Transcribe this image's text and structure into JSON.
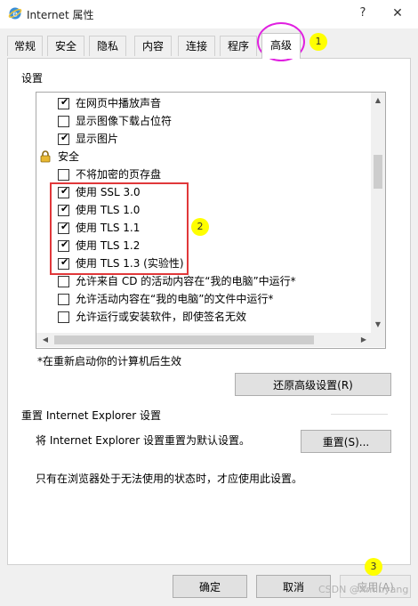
{
  "window": {
    "title": "Internet 属性",
    "help_label": "?",
    "close_label": "✕"
  },
  "tabs": [
    {
      "label": "常规",
      "active": false
    },
    {
      "label": "安全",
      "active": false
    },
    {
      "label": "隐私",
      "active": false
    },
    {
      "label": "内容",
      "active": false
    },
    {
      "label": "连接",
      "active": false
    },
    {
      "label": "程序",
      "active": false
    },
    {
      "label": "高级",
      "active": true
    }
  ],
  "settings": {
    "group_label": "设置",
    "items": [
      {
        "type": "checkbox",
        "label": "在网页中播放声音",
        "checked": true
      },
      {
        "type": "checkbox",
        "label": "显示图像下载占位符",
        "checked": false
      },
      {
        "type": "checkbox",
        "label": "显示图片",
        "checked": true
      },
      {
        "type": "category",
        "label": "安全",
        "icon": "lock-icon"
      },
      {
        "type": "checkbox",
        "label": "不将加密的页存盘",
        "checked": false
      },
      {
        "type": "checkbox",
        "label": "使用 SSL 3.0",
        "checked": true
      },
      {
        "type": "checkbox",
        "label": "使用 TLS 1.0",
        "checked": true
      },
      {
        "type": "checkbox",
        "label": "使用 TLS 1.1",
        "checked": true
      },
      {
        "type": "checkbox",
        "label": "使用 TLS 1.2",
        "checked": true
      },
      {
        "type": "checkbox",
        "label": "使用 TLS 1.3 (实验性)",
        "checked": true
      },
      {
        "type": "checkbox",
        "label": "允许来自 CD 的活动内容在“我的电脑”中运行*",
        "checked": false
      },
      {
        "type": "checkbox",
        "label": "允许活动内容在“我的电脑”的文件中运行*",
        "checked": false
      },
      {
        "type": "checkbox",
        "label": "允许运行或安装软件，即使签名无效",
        "checked": false
      }
    ],
    "restart_note": "*在重新启动你的计算机后生效",
    "restore_button": "还原高级设置(R)"
  },
  "reset": {
    "heading": "重置 Internet Explorer 设置",
    "description": "将 Internet Explorer 设置重置为默认设置。",
    "button": "重置(S)...",
    "note": "只有在浏览器处于无法使用的状态时，才应使用此设置。"
  },
  "footer": {
    "ok": "确定",
    "cancel": "取消",
    "apply": "应用(A)"
  },
  "annotations": {
    "badge_1": "1",
    "badge_2": "2",
    "badge_3": "3",
    "circle_color": "#e020e0",
    "rect_color": "#e0383a",
    "badge_color": "#ffff00"
  },
  "watermark": "CSDN @Xminyang"
}
